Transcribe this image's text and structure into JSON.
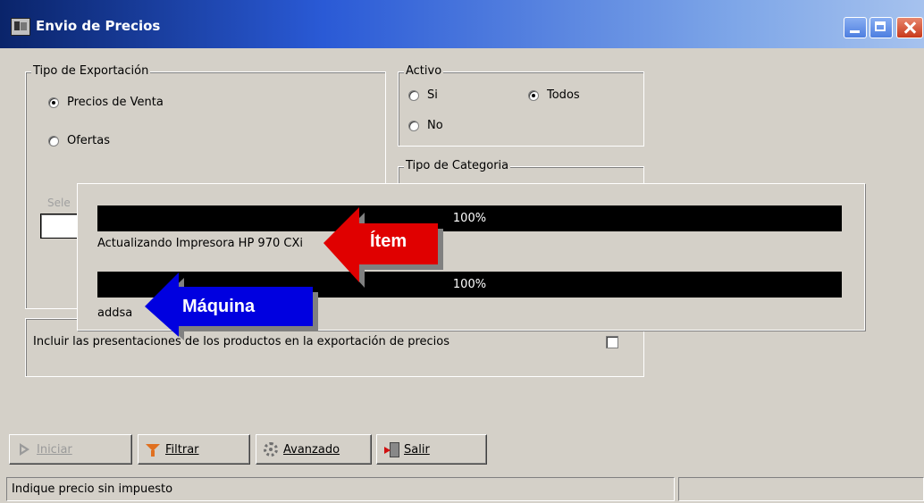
{
  "window": {
    "title": "Envio de Precios"
  },
  "tipo_exportacion": {
    "label": "Tipo de Exportación",
    "options": [
      {
        "label": "Precios de Venta",
        "selected": true
      },
      {
        "label": "Ofertas",
        "selected": false
      }
    ],
    "obscured_label": "Sele"
  },
  "activo": {
    "label": "Activo",
    "options": [
      {
        "label": "Si",
        "selected": false
      },
      {
        "label": "Todos",
        "selected": true
      },
      {
        "label": "No",
        "selected": false
      }
    ]
  },
  "tipo_categoria": {
    "label": "Tipo de Categoria"
  },
  "progress": {
    "bar1": {
      "text": "100%",
      "value": 1.0
    },
    "bar1_status": "Actualizando Impresora HP 970 CXi",
    "bar2": {
      "text": "100%",
      "value": 1.0
    },
    "bar2_status": "addsa"
  },
  "callouts": {
    "item": {
      "label": "Ítem",
      "color": "#e00000"
    },
    "maquina": {
      "label": "Máquina",
      "color": "#0000e0"
    }
  },
  "presentaciones": {
    "label": "Incluir las presentaciones de los productos en la exportación de precios",
    "checked": false
  },
  "buttons": {
    "iniciar": {
      "label": "Iniciar",
      "enabled": false
    },
    "filtrar": {
      "label": "Filtrar"
    },
    "avanzado": {
      "label": "Avanzado"
    },
    "salir": {
      "label": "Salir"
    }
  },
  "status": {
    "message": "Indique precio sin impuesto",
    "secondary": ""
  }
}
